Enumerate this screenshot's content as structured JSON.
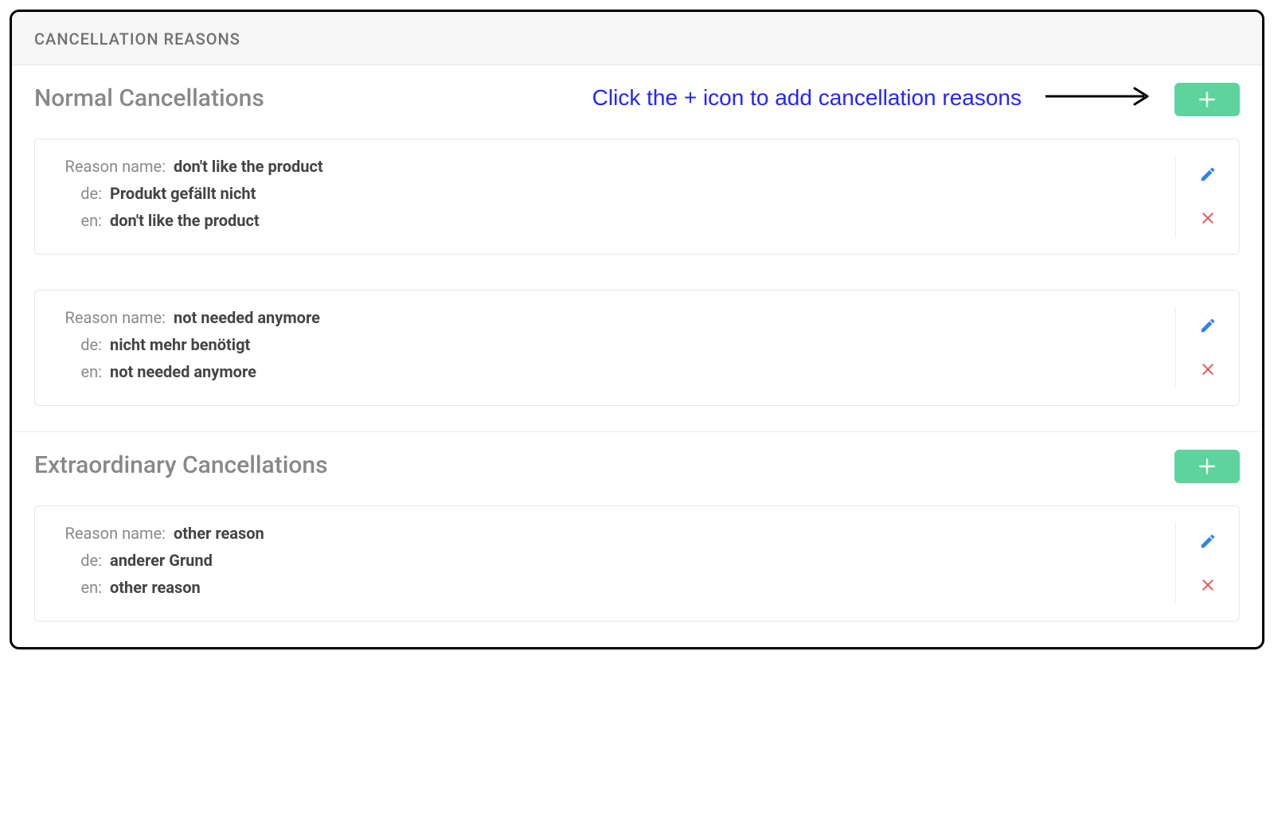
{
  "panel": {
    "title": "CANCELLATION REASONS"
  },
  "labels": {
    "reason_name": "Reason name:",
    "de": "de:",
    "en": "en:"
  },
  "annotation": {
    "text": "Click the + icon to add cancellation reasons"
  },
  "sections": [
    {
      "title": "Normal Cancellations",
      "show_annotation": true,
      "reasons": [
        {
          "name": "don't like the product",
          "de": "Produkt gefällt nicht",
          "en": "don't like the product"
        },
        {
          "name": "not needed anymore",
          "de": "nicht mehr benötigt",
          "en": "not needed anymore"
        }
      ]
    },
    {
      "title": "Extraordinary Cancellations",
      "show_annotation": false,
      "reasons": [
        {
          "name": "other reason",
          "de": "anderer Grund",
          "en": "other reason"
        }
      ]
    }
  ]
}
